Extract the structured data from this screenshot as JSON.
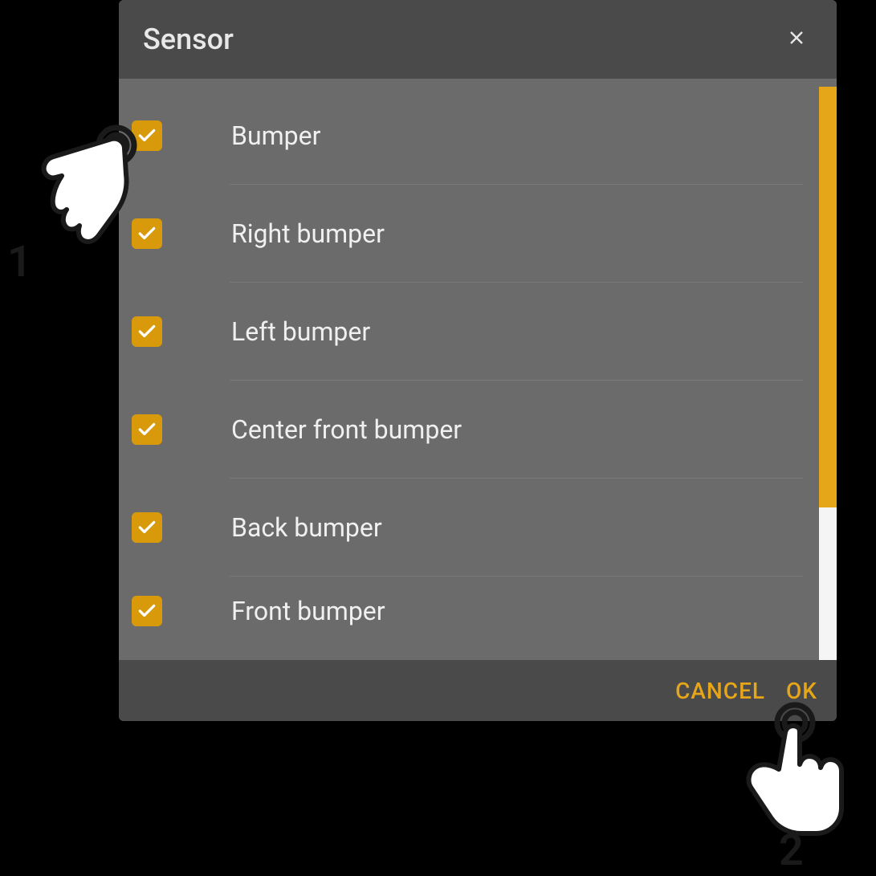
{
  "dialog": {
    "title": "Sensor"
  },
  "sensors": [
    {
      "label": "Bumper",
      "checked": true
    },
    {
      "label": "Right bumper",
      "checked": true
    },
    {
      "label": "Left bumper",
      "checked": true
    },
    {
      "label": "Center front bumper",
      "checked": true
    },
    {
      "label": "Back bumper",
      "checked": true
    },
    {
      "label": "Front bumper",
      "checked": true
    }
  ],
  "footer": {
    "cancel": "CANCEL",
    "ok": "OK"
  },
  "indicators": {
    "step1": "1",
    "step2": "2"
  },
  "colors": {
    "accent": "#e5a61a",
    "checkbox": "#d89a0a"
  }
}
